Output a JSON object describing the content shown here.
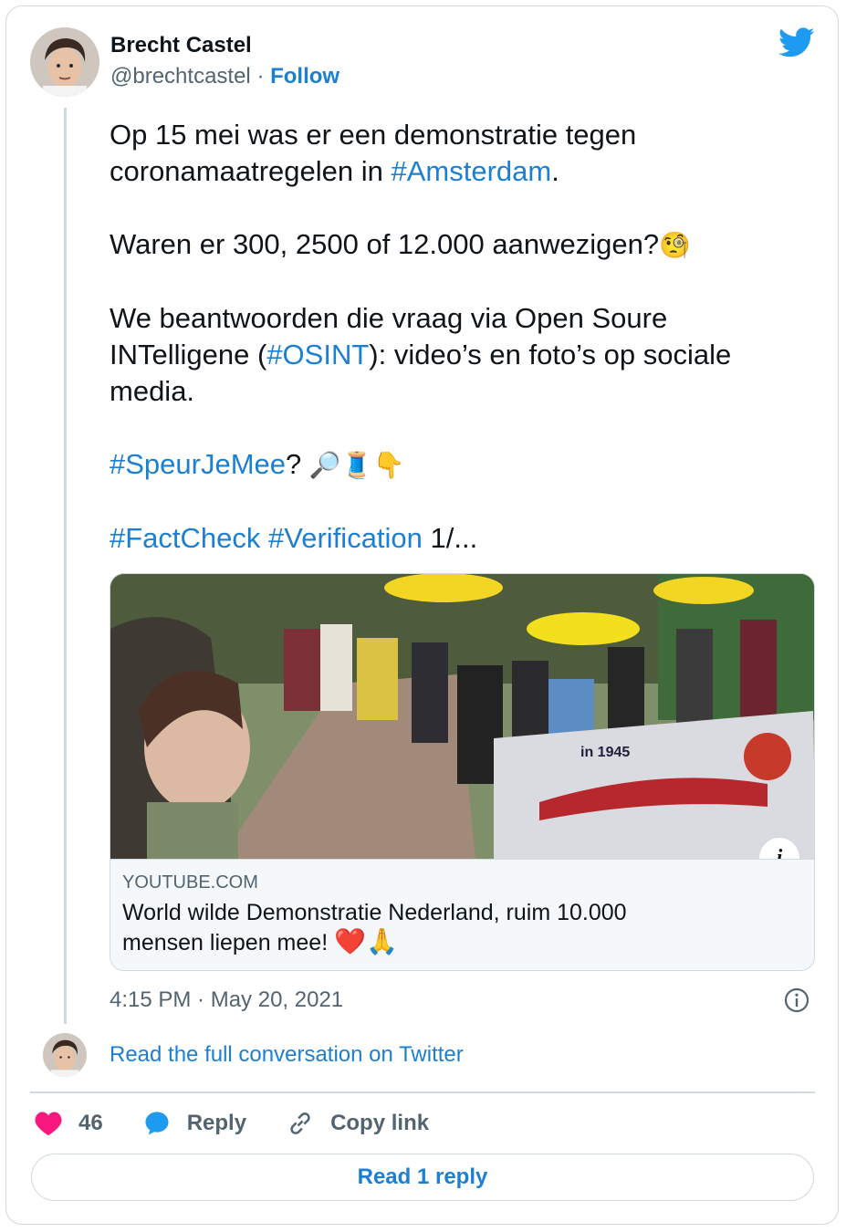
{
  "author": {
    "name": "Brecht Castel",
    "handle": "@brechtcastel",
    "separator": "·",
    "follow_label": "Follow"
  },
  "tweet": {
    "line1": "Op 15 mei was er een demonstratie tegen",
    "line2_prefix": "coronamaatregelen in ",
    "line2_tag": "#Amsterdam",
    "line2_suffix": ".",
    "question": "Waren er 300, 2500 of 12.000 aanwezigen?",
    "question_emoji": "🧐",
    "p3_line1": "We beantwoorden die vraag via Open Soure",
    "p3_line2_prefix": "INTelligene (",
    "p3_line2_tag": "#OSINT",
    "p3_line2_suffix": "): video’s en foto’s op sociale",
    "p3_line3": "media.",
    "speur_tag": "#SpeurJeMee",
    "speur_suffix": "?",
    "speur_emojis": "🔎🧵👇",
    "fact_tag": "#FactCheck",
    "verif_tag": "#Verification",
    "counter": "1/..."
  },
  "media": {
    "domain": "YOUTUBE.COM",
    "title_line1": "World wilde Demonstratie Nederland, ruim 10.000",
    "title_line2": "mensen liepen mee!",
    "title_emojis": "❤️🙏",
    "banner_text": "in 1945",
    "info_label": "i"
  },
  "timestamp": "4:15 PM · May 20, 2021",
  "read_full_label": "Read the full conversation on Twitter",
  "actions": {
    "like_count": "46",
    "reply_label": "Reply",
    "copy_label": "Copy link"
  },
  "read_reply_label": "Read 1 reply",
  "colors": {
    "link": "#1d7fd1",
    "like": "#f91880",
    "border": "#cfd9de",
    "muted": "#536471"
  }
}
